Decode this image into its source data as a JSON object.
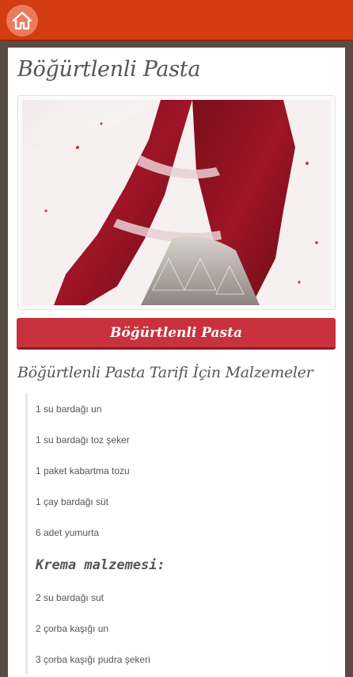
{
  "header": {
    "home_icon": "home-icon"
  },
  "recipe": {
    "title": "Böğürtlenli Pasta",
    "image_alt": "Böğürtlenli Pasta",
    "button_label": "Böğürtlenli Pasta",
    "ingredients_heading": "Böğürtlenli Pasta Tarifi İçin Malzemeler",
    "ingredients": [
      "1 su bardağı un",
      "1 su bardağı toz şeker",
      "1 paket kabartma tozu",
      "1 çay bardağı süt",
      "6 adet yumurta"
    ],
    "cream_heading": "Krema malzemesi:",
    "cream_ingredients": [
      "2 su bardağı sut",
      "2 çorba kaşığı un",
      "3 çorba kaşığı pudra şekeri"
    ]
  },
  "colors": {
    "topbar": "#d43c12",
    "home_button": "#ee7a5c",
    "title_button": "#c9323c",
    "frame": "#5a4a46"
  }
}
